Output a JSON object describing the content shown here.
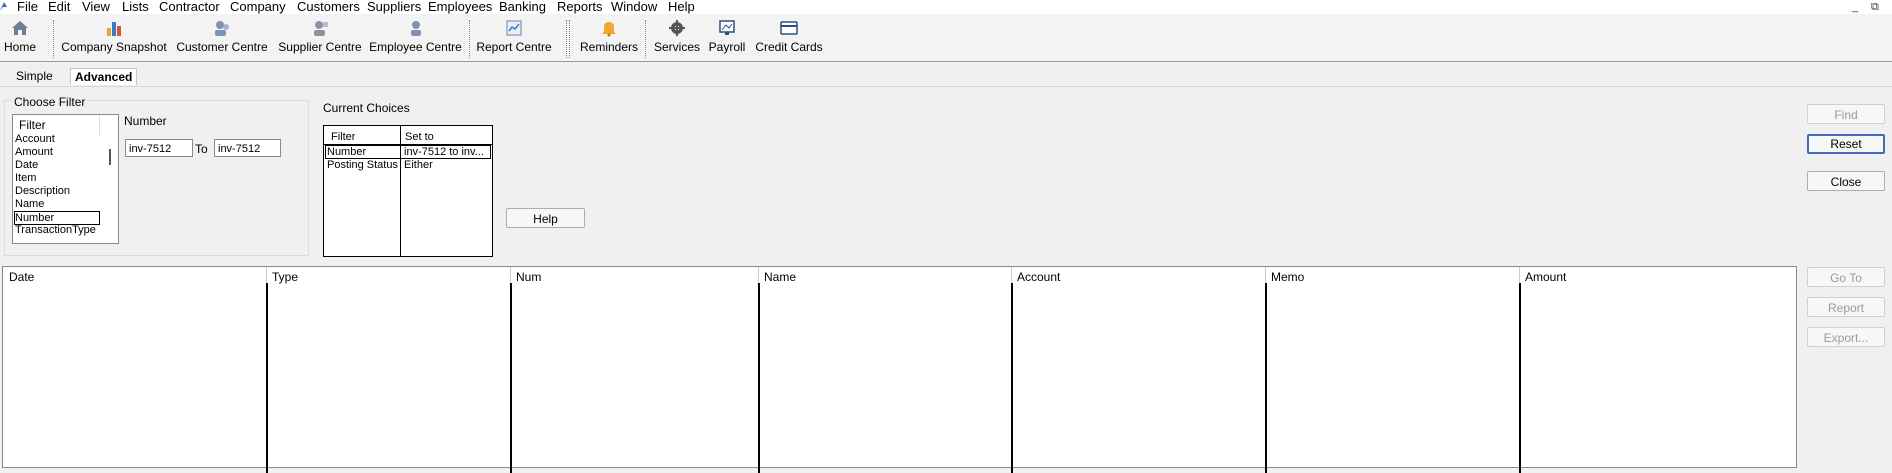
{
  "menu": [
    "File",
    "Edit",
    "View",
    "Lists",
    "Contractor",
    "Company",
    "Customers",
    "Suppliers",
    "Employees",
    "Banking",
    "Reports",
    "Window",
    "Help"
  ],
  "window_controls": {
    "minimize": "_",
    "restore": "⧉"
  },
  "toolbar": [
    {
      "label": "Home",
      "icon": "home-icon"
    },
    {
      "label": "Company Snapshot",
      "icon": "bar-chart-icon"
    },
    {
      "label": "Customer Centre",
      "icon": "customers-icon"
    },
    {
      "label": "Supplier Centre",
      "icon": "suppliers-icon"
    },
    {
      "label": "Employee Centre",
      "icon": "employees-icon"
    },
    {
      "label": "Report Centre",
      "icon": "reports-icon"
    },
    {
      "label": "Reminders",
      "icon": "bell-icon"
    },
    {
      "label": "Services",
      "icon": "gear-icon"
    },
    {
      "label": "Payroll",
      "icon": "payroll-icon"
    },
    {
      "label": "Credit Cards",
      "icon": "credit-card-icon"
    }
  ],
  "tabs": {
    "simple": "Simple",
    "advanced": "Advanced"
  },
  "choose_filter": {
    "title": "Choose Filter",
    "list_header": "Filter",
    "items": [
      "Account",
      "Amount",
      "Date",
      "Item",
      "Description",
      "Name",
      "Number",
      "TransactionType"
    ],
    "selected": "Number"
  },
  "number_filter": {
    "label": "Number",
    "from_value": "inv-7512",
    "to_label": "To",
    "to_value": "inv-7512"
  },
  "current_choices": {
    "title": "Current Choices",
    "headers": [
      "Filter",
      "Set to"
    ],
    "rows": [
      [
        "Number",
        "inv-7512 to inv..."
      ],
      [
        "Posting Status",
        "Either"
      ]
    ]
  },
  "buttons": {
    "help": "Help",
    "find": "Find",
    "reset": "Reset",
    "close": "Close",
    "go_to": "Go To",
    "report": "Report",
    "export": "Export..."
  },
  "results_columns": [
    "Date",
    "Type",
    "Num",
    "Name",
    "Account",
    "Memo",
    "Amount"
  ]
}
